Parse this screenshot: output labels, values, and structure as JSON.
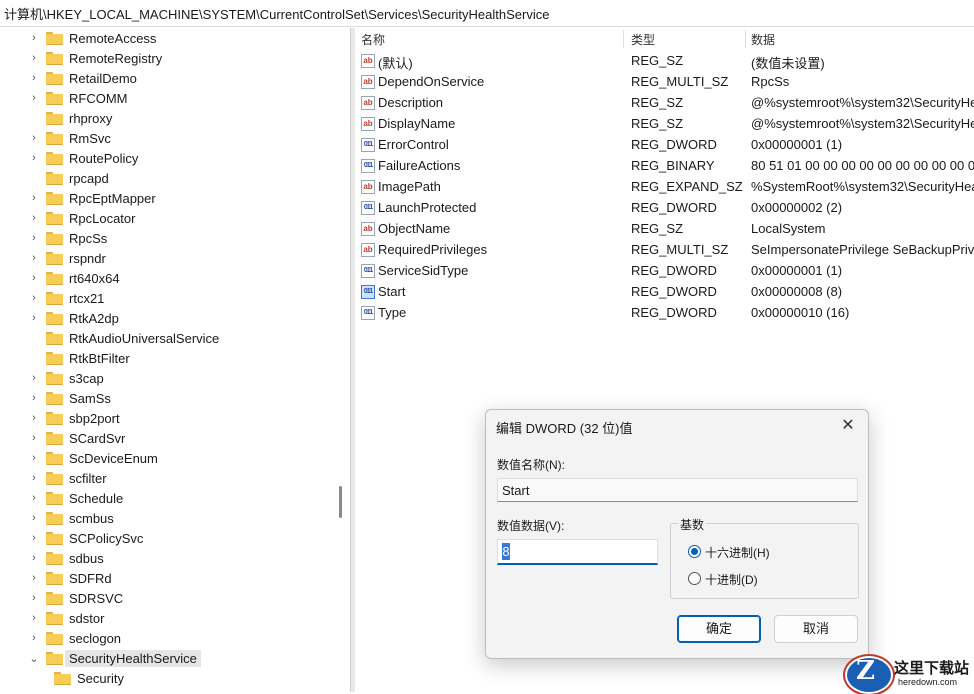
{
  "address": "计算机\\HKEY_LOCAL_MACHINE\\SYSTEM\\CurrentControlSet\\Services\\SecurityHealthService",
  "tree": {
    "items": [
      {
        "label": "RemoteAccess",
        "expand": "›"
      },
      {
        "label": "RemoteRegistry",
        "expand": "›"
      },
      {
        "label": "RetailDemo",
        "expand": "›"
      },
      {
        "label": "RFCOMM",
        "expand": "›"
      },
      {
        "label": "rhproxy",
        "expand": ""
      },
      {
        "label": "RmSvc",
        "expand": "›"
      },
      {
        "label": "RoutePolicy",
        "expand": "›"
      },
      {
        "label": "rpcapd",
        "expand": ""
      },
      {
        "label": "RpcEptMapper",
        "expand": "›"
      },
      {
        "label": "RpcLocator",
        "expand": "›"
      },
      {
        "label": "RpcSs",
        "expand": "›"
      },
      {
        "label": "rspndr",
        "expand": "›"
      },
      {
        "label": "rt640x64",
        "expand": "›"
      },
      {
        "label": "rtcx21",
        "expand": "›"
      },
      {
        "label": "RtkA2dp",
        "expand": "›"
      },
      {
        "label": "RtkAudioUniversalService",
        "expand": ""
      },
      {
        "label": "RtkBtFilter",
        "expand": ""
      },
      {
        "label": "s3cap",
        "expand": "›"
      },
      {
        "label": "SamSs",
        "expand": "›"
      },
      {
        "label": "sbp2port",
        "expand": "›"
      },
      {
        "label": "SCardSvr",
        "expand": "›"
      },
      {
        "label": "ScDeviceEnum",
        "expand": "›"
      },
      {
        "label": "scfilter",
        "expand": "›"
      },
      {
        "label": "Schedule",
        "expand": "›"
      },
      {
        "label": "scmbus",
        "expand": "›"
      },
      {
        "label": "SCPolicySvc",
        "expand": "›"
      },
      {
        "label": "sdbus",
        "expand": "›"
      },
      {
        "label": "SDFRd",
        "expand": "›"
      },
      {
        "label": "SDRSVC",
        "expand": "›"
      },
      {
        "label": "sdstor",
        "expand": "›"
      },
      {
        "label": "seclogon",
        "expand": "›"
      },
      {
        "label": "SecurityHealthService",
        "expand": "⌄",
        "selected": true
      },
      {
        "label": "Security",
        "expand": "",
        "child": true
      }
    ]
  },
  "values": {
    "headers": {
      "name": "名称",
      "type": "类型",
      "data": "数据"
    },
    "rows": [
      {
        "icon": "ab",
        "name": "(默认)",
        "type": "REG_SZ",
        "data": "(数值未设置)"
      },
      {
        "icon": "ab",
        "name": "DependOnService",
        "type": "REG_MULTI_SZ",
        "data": "RpcSs"
      },
      {
        "icon": "ab",
        "name": "Description",
        "type": "REG_SZ",
        "data": "@%systemroot%\\system32\\SecurityHe"
      },
      {
        "icon": "ab",
        "name": "DisplayName",
        "type": "REG_SZ",
        "data": "@%systemroot%\\system32\\SecurityHe"
      },
      {
        "icon": "bin",
        "name": "ErrorControl",
        "type": "REG_DWORD",
        "data": "0x00000001 (1)"
      },
      {
        "icon": "bin",
        "name": "FailureActions",
        "type": "REG_BINARY",
        "data": "80 51 01 00 00 00 00 00 00 00 00 00 0"
      },
      {
        "icon": "ab",
        "name": "ImagePath",
        "type": "REG_EXPAND_SZ",
        "data": "%SystemRoot%\\system32\\SecurityHea"
      },
      {
        "icon": "bin",
        "name": "LaunchProtected",
        "type": "REG_DWORD",
        "data": "0x00000002 (2)"
      },
      {
        "icon": "ab",
        "name": "ObjectName",
        "type": "REG_SZ",
        "data": "LocalSystem"
      },
      {
        "icon": "ab",
        "name": "RequiredPrivileges",
        "type": "REG_MULTI_SZ",
        "data": "SeImpersonatePrivilege SeBackupPrivi"
      },
      {
        "icon": "bin",
        "name": "ServiceSidType",
        "type": "REG_DWORD",
        "data": "0x00000001 (1)"
      },
      {
        "icon": "bin",
        "name": "Start",
        "type": "REG_DWORD",
        "data": "0x00000008 (8)",
        "selected": true
      },
      {
        "icon": "bin",
        "name": "Type",
        "type": "REG_DWORD",
        "data": "0x00000010 (16)"
      }
    ]
  },
  "dialog": {
    "title": "编辑 DWORD (32 位)值",
    "close_glyph": "✕",
    "name_label": "数值名称(N):",
    "name_value": "Start",
    "data_label": "数值数据(V):",
    "data_value": "8",
    "base_label": "基数",
    "hex_label": "十六进制(H)",
    "dec_label": "十进制(D)",
    "ok_label": "确定",
    "cancel_label": "取消"
  },
  "watermark": {
    "logo_letter": "Z",
    "text": "这里下载站",
    "sub": "heredown.com"
  },
  "colors": {
    "accent": "#005fb8",
    "folder": "#f7cd57"
  }
}
